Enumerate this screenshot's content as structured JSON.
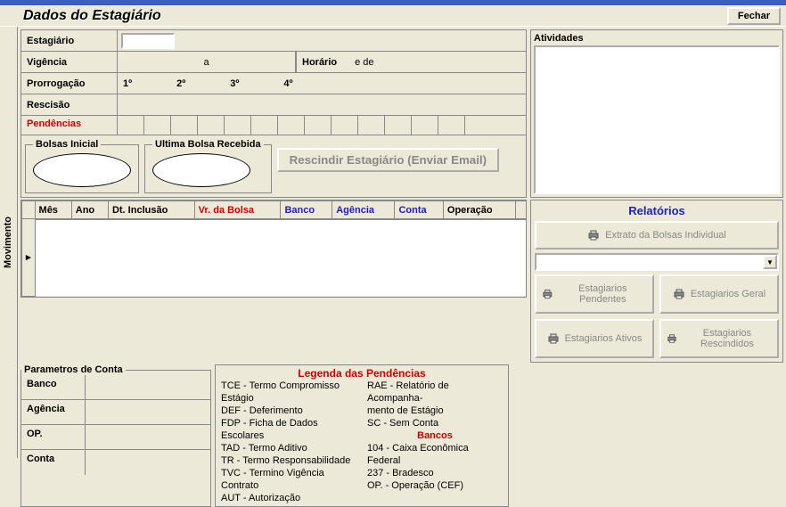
{
  "header": {
    "title": "Dados do Estagiário",
    "close": "Fechar"
  },
  "sideTab": "Movimento",
  "form": {
    "estagiario_label": "Estagiário",
    "vigencia_label": "Vigência",
    "vigencia_sep": "a",
    "horario_label": "Horário",
    "horario_sep": "e de",
    "prorrog_label": "Prorrogação",
    "prorrog1": "1º",
    "prorrog2": "2º",
    "prorrog3": "3º",
    "prorrog4": "4º",
    "rescisao_label": "Rescisão",
    "pendencias_label": "Pendências",
    "bolsa_inicial": "Bolsas Inicial",
    "ultima_bolsa": "Ultima Bolsa Recebida",
    "rescindir_btn": "Rescindir Estagiário (Enviar Email)"
  },
  "atividades_label": "Atividades",
  "grid": {
    "mes": "Mês",
    "ano": "Ano",
    "dt_inclusao": "Dt. Inclusão",
    "vr_bolsa": "Vr. da Bolsa",
    "banco": "Banco",
    "agencia": "Agência",
    "conta": "Conta",
    "operacao": "Operação"
  },
  "relatorios": {
    "title": "Relatórios",
    "extrato": "Extrato da Bolsas Individual",
    "pendentes": "Estagiarios Pendentes",
    "geral": "Estagiarios Geral",
    "ativos": "Estagiarios Ativos",
    "rescindidos": "Estagiarios Rescindidos"
  },
  "parametros": {
    "title": "Parametros de Conta",
    "banco": "Banco",
    "agencia": "Agência",
    "op": "OP.",
    "conta": "Conta"
  },
  "legenda": {
    "title": "Legenda das Pendências",
    "left": [
      "TCE - Termo Compromisso Estágio",
      "DEF - Deferimento",
      "FDP - Ficha de Dados Escolares",
      "TAD - Termo Aditivo",
      "TR  - Termo Responsabilidade",
      "TVC - Termino Vigência  Contrato",
      "AUT - Autorização"
    ],
    "right_top": [
      "RAE - Relatório de Acompanha-",
      "            mento de Estágio",
      "SC  - Sem Conta"
    ],
    "bancos_title": "Bancos",
    "right_bottom": [
      "104 - Caixa Econômica Federal",
      "237 - Bradesco",
      "OP. - Operação (CEF)"
    ]
  }
}
